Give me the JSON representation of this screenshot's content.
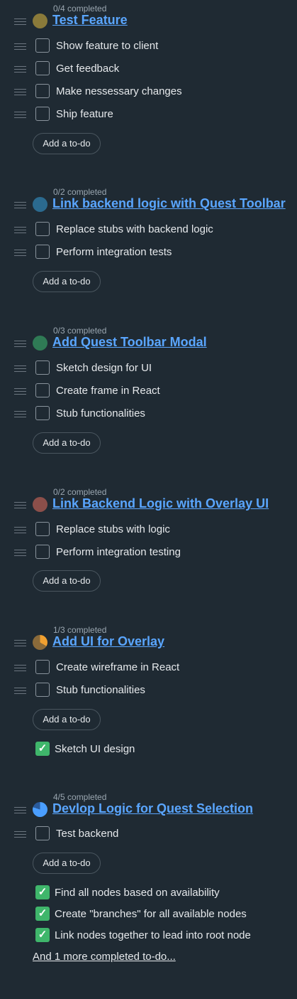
{
  "groups": [
    {
      "progress": "0/4 completed",
      "title": "Test Feature",
      "pie_color": "#8a7a3a",
      "todos": [
        "Show feature to client",
        "Get feedback",
        "Make nessessary changes",
        "Ship feature"
      ],
      "add_label": "Add a to-do",
      "done": []
    },
    {
      "progress": "0/2 completed",
      "title": "Link backend logic with Quest Toolbar",
      "pie_color": "#2b6a8f",
      "todos": [
        "Replace stubs with backend logic",
        "Perform integration tests"
      ],
      "add_label": "Add a to-do",
      "done": []
    },
    {
      "progress": "0/3 completed",
      "title": "Add Quest Toolbar Modal",
      "pie_color": "#2f7a55",
      "todos": [
        "Sketch design for UI",
        "Create frame in React",
        "Stub functionalities"
      ],
      "add_label": "Add a to-do",
      "done": []
    },
    {
      "progress": "0/2 completed",
      "title": "Link Backend Logic with Overlay UI",
      "pie_color": "#8c4f4a",
      "todos": [
        "Replace stubs with logic",
        "Perform integration testing"
      ],
      "add_label": "Add a to-do",
      "done": []
    },
    {
      "progress": "1/3 completed",
      "title": "Add UI for Overlay",
      "pie_color": "#f0a030",
      "pie_bg": "#8a6a3a",
      "pie_fraction": 0.3333,
      "todos": [
        "Create wireframe in React",
        "Stub functionalities"
      ],
      "add_label": "Add a to-do",
      "done": [
        "Sketch UI design"
      ]
    },
    {
      "progress": "4/5 completed",
      "title": "Devlop Logic for Quest Selection",
      "pie_color": "#4a9eff",
      "pie_bg": "#2a5a9a",
      "pie_fraction": 0.8,
      "todos": [
        "Test backend"
      ],
      "add_label": "Add a to-do",
      "done": [
        "Find all nodes based on availability",
        "Create \"branches\" for all available nodes",
        "Link nodes together to lead into root node"
      ],
      "more_link": "And 1 more completed to-do..."
    }
  ],
  "check_glyph": "✓"
}
